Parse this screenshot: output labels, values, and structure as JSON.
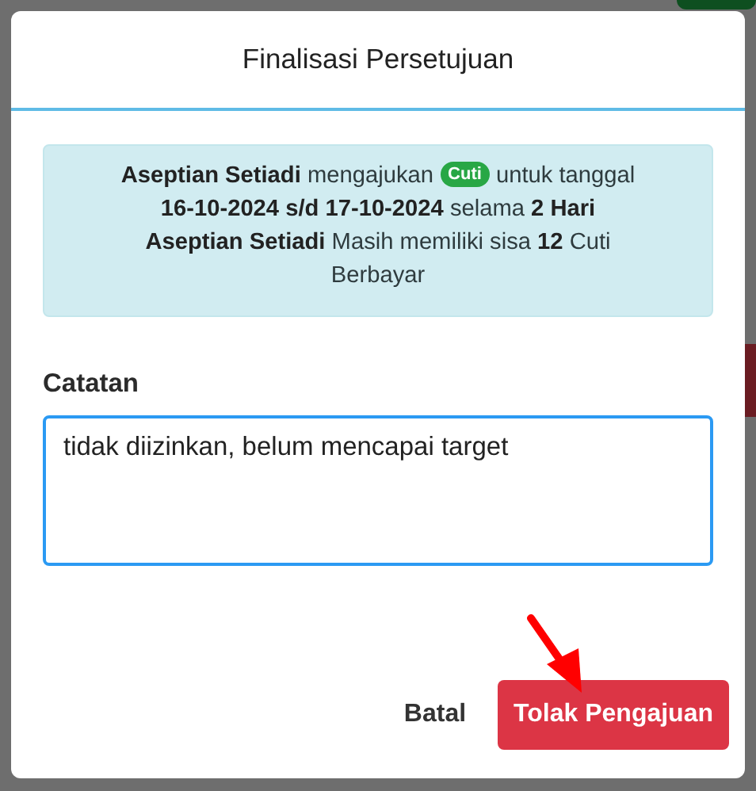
{
  "dialog": {
    "title": "Finalisasi Persetujuan"
  },
  "alert": {
    "text_before": "**Aseptian Setiadi** mengajukan",
    "badge": "Cuti",
    "text_after": "untuk tanggal",
    "period": "**16-10-2024 s/d 17-10-2024** selama **2 Hari**",
    "remaining": "**Aseptian Setiadi** Masih memiliki sisa **12** Cuti Berbayar"
  },
  "notes": {
    "label": "Catatan",
    "value": "tidak diizinkan, belum mencapai target",
    "focused": true
  },
  "buttons": [
    {
      "label": "Batal",
      "kind": "secondary"
    },
    {
      "label": "Tolak Pengajuan",
      "kind": "danger"
    }
  ]
}
